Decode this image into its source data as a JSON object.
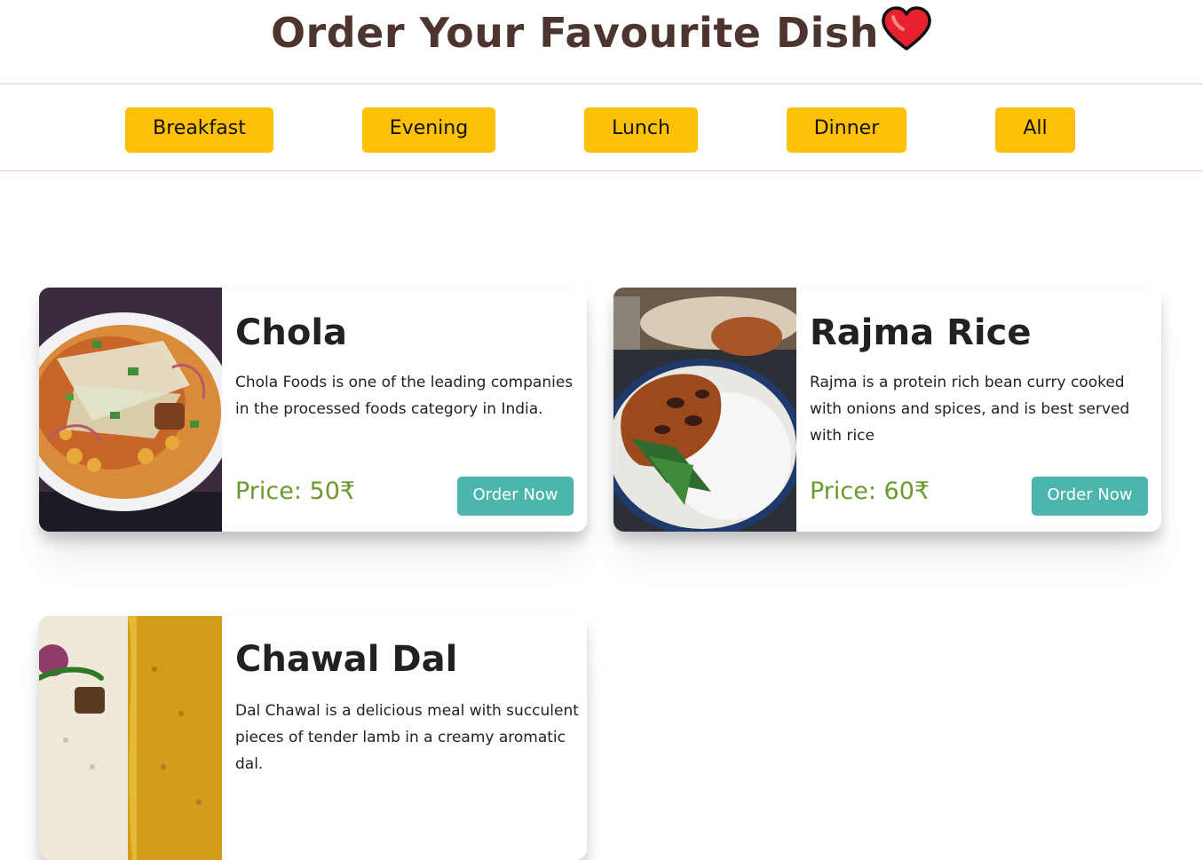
{
  "header": {
    "title": "Order Your Favourite Dish",
    "icon": "heart-icon"
  },
  "menu": {
    "items": [
      {
        "label": "Breakfast"
      },
      {
        "label": "Evening"
      },
      {
        "label": "Lunch"
      },
      {
        "label": "Dinner"
      },
      {
        "label": "All"
      }
    ]
  },
  "dishes": [
    {
      "name": "Chola",
      "description": "Chola Foods is one of the leading companies in the processed foods category in India.",
      "price": "Price: 50₹",
      "order_label": "Order Now"
    },
    {
      "name": "Rajma Rice",
      "description": "Rajma is a protein rich bean curry cooked with onions and spices, and is best served with rice",
      "price": "Price: 60₹",
      "order_label": "Order Now"
    },
    {
      "name": "Chawal Dal",
      "description": "Dal Chawal is a delicious meal with succulent pieces of tender lamb in a creamy aromatic dal.",
      "price": "",
      "order_label": ""
    }
  ],
  "colors": {
    "title": "#4e342e",
    "menu_button": "#ffc107",
    "order_button": "#4db6ac",
    "price": "#6a9a2e",
    "heart": "#e8212f"
  }
}
